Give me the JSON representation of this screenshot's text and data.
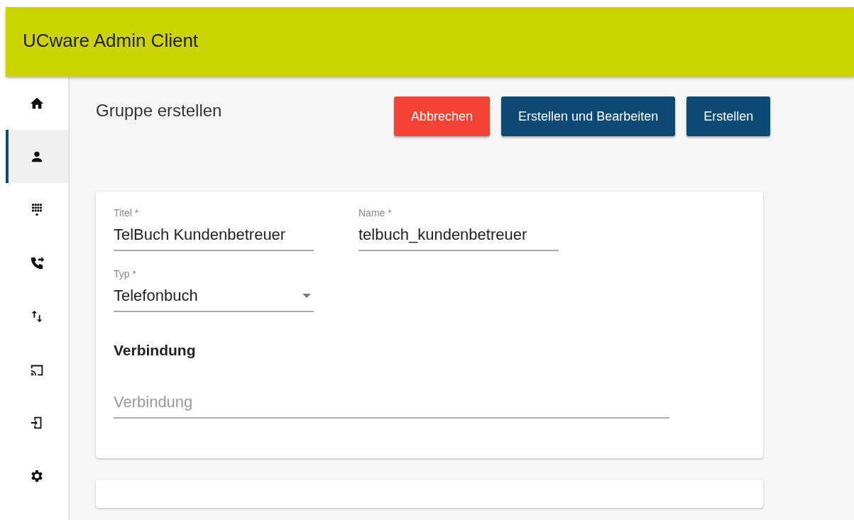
{
  "header": {
    "title": "UCware Admin Client"
  },
  "sidebar": {
    "items": [
      {
        "kind": "home",
        "selected": false
      },
      {
        "kind": "person",
        "selected": true
      },
      {
        "kind": "dialpad",
        "selected": false
      },
      {
        "kind": "forward",
        "selected": false
      },
      {
        "kind": "swap",
        "selected": false
      },
      {
        "kind": "cast",
        "selected": false
      },
      {
        "kind": "login",
        "selected": false
      },
      {
        "kind": "settings",
        "selected": false
      }
    ]
  },
  "page": {
    "title": "Gruppe erstellen",
    "buttons": [
      {
        "label": "Abbrechen",
        "kind": "cancel"
      },
      {
        "label": "Erstellen und Bearbeiten",
        "kind": "primary"
      },
      {
        "label": "Erstellen",
        "kind": "primary"
      }
    ]
  },
  "form": {
    "fields": [
      {
        "label": "Titel *",
        "value": "TelBuch Kundenbetreuer",
        "kind": "text"
      },
      {
        "label": "Name *",
        "value": "telbuch_kundenbetreuer",
        "kind": "text"
      },
      {
        "label": "Typ *",
        "value": "Telefonbuch",
        "kind": "select"
      }
    ],
    "section": {
      "heading": "Verbindung",
      "placeholder": "Verbindung"
    }
  }
}
